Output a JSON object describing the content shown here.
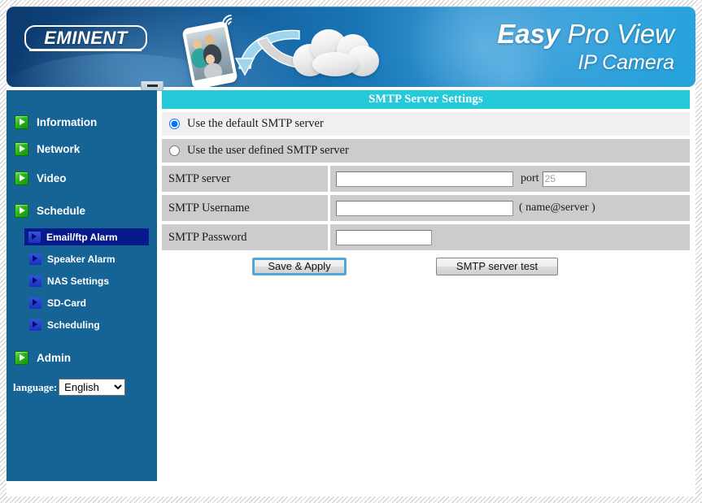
{
  "banner": {
    "logo_text": "EMINENT",
    "brand_line1_bold": "Easy",
    "brand_line1_light": "Pro View",
    "brand_line2": "IP Camera",
    "icons": [
      "phone-icon",
      "wifi-icon",
      "arrow-down-icon",
      "arrow-up-icon",
      "cloud-icon"
    ],
    "colors": {
      "gradient_start": "#0b3a6e",
      "gradient_end": "#27a4de"
    }
  },
  "sidebar": {
    "background": "#166496",
    "top_items": [
      {
        "label": "Information",
        "icon": "green-play-icon"
      },
      {
        "label": "Network",
        "icon": "green-play-icon"
      },
      {
        "label": "Video",
        "icon": "green-play-icon"
      },
      {
        "label": "Schedule",
        "icon": "green-play-icon"
      },
      {
        "label": "Admin",
        "icon": "green-play-icon"
      }
    ],
    "sub_items": [
      {
        "label": "Email/ftp Alarm",
        "icon": "blue-play-icon",
        "selected": true
      },
      {
        "label": "Speaker Alarm",
        "icon": "blue-play-icon",
        "selected": false
      },
      {
        "label": "NAS Settings",
        "icon": "blue-play-icon",
        "selected": false
      },
      {
        "label": "SD-Card",
        "icon": "blue-play-icon",
        "selected": false
      },
      {
        "label": "Scheduling",
        "icon": "blue-play-icon",
        "selected": false
      }
    ],
    "selected_bg": "#071a8c",
    "language": {
      "label": "language:",
      "value": "English",
      "options": [
        "English"
      ]
    }
  },
  "collapse_tab": {
    "icon": "collapse-handle-icon"
  },
  "main": {
    "panel_title": "SMTP Server Settings",
    "panel_title_bg": "#24c9da",
    "radio_group": {
      "name": "smtp-mode",
      "options": [
        {
          "label": "Use the default SMTP server",
          "checked": true
        },
        {
          "label": "Use the user defined SMTP server",
          "checked": false
        }
      ]
    },
    "fields": [
      {
        "label": "SMTP server",
        "value": "",
        "port_label": "port",
        "port_value": "25"
      },
      {
        "label": "SMTP Username",
        "value": "",
        "note": "( name@server )"
      },
      {
        "label": "SMTP Password",
        "value": ""
      }
    ],
    "buttons": {
      "save": "Save & Apply",
      "test": "SMTP server test"
    }
  }
}
